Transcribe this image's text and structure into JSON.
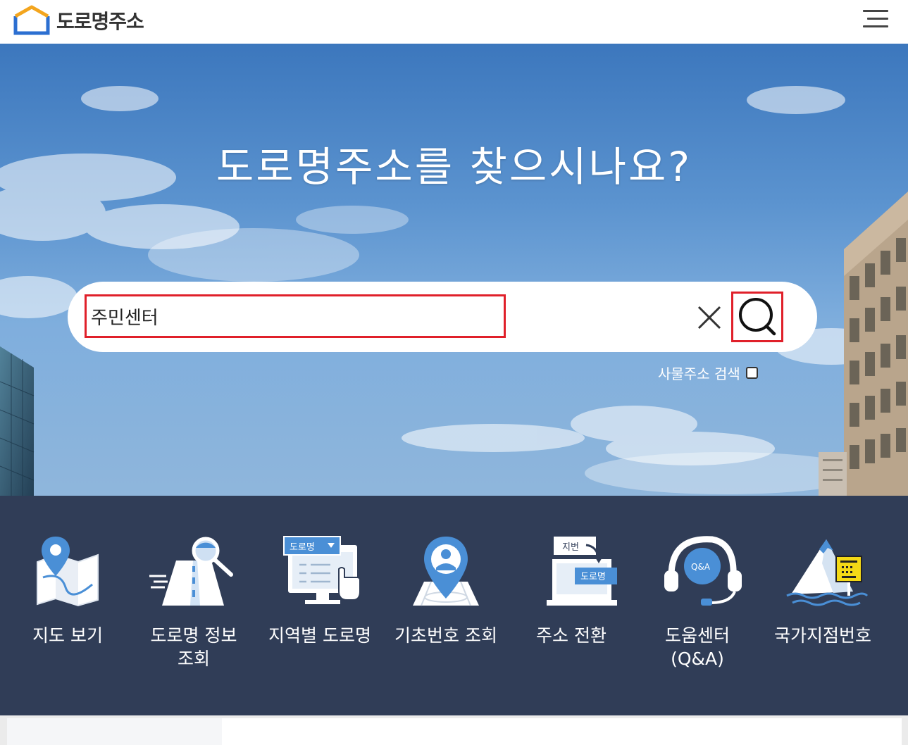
{
  "header": {
    "logo_text": "도로명주소",
    "logo_icon": "house-outline-icon",
    "menu_icon": "hamburger-menu-icon"
  },
  "hero": {
    "title": "도로명주소를 찾으시나요?",
    "search": {
      "value": "주민센터",
      "clear_icon": "close-icon",
      "search_icon": "search-icon"
    },
    "building_search_label": "사물주소 검색",
    "building_search_checked": false
  },
  "menu": {
    "items": [
      {
        "label": "지도 보기",
        "icon": "map-pin-icon"
      },
      {
        "label": "도로명 정보\n조회",
        "icon": "road-search-icon"
      },
      {
        "label": "지역별 도로명",
        "icon": "road-name-monitor-icon"
      },
      {
        "label": "기초번호 조회",
        "icon": "location-person-icon"
      },
      {
        "label": "주소 전환",
        "icon": "address-convert-icon"
      },
      {
        "label": "도움센터\n(Q&A)",
        "icon": "headset-qa-icon"
      },
      {
        "label": "국가지점번호",
        "icon": "mountain-sign-icon"
      }
    ],
    "icon_texts": {
      "road_name": "도로명",
      "jibun": "지번",
      "convert_road": "도로명",
      "qa": "Q&A"
    }
  },
  "colors": {
    "menu_bg": "#303d57",
    "highlight": "#e0202a",
    "icon_blue": "#4a8fd6"
  }
}
